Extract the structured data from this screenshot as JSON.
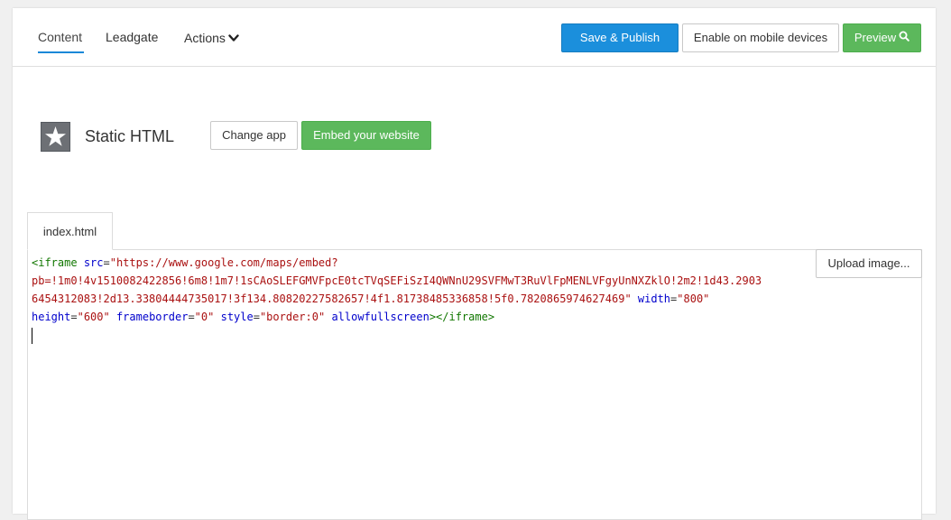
{
  "nav": {
    "tabs": [
      {
        "label": "Content",
        "active": true
      },
      {
        "label": "Leadgate",
        "active": false
      },
      {
        "label": "Actions",
        "active": false
      }
    ]
  },
  "toolbar": {
    "save_publish_label": "Save & Publish",
    "mobile_label": "Enable on mobile devices",
    "preview_label": "Preview",
    "preview_icon": "search-icon"
  },
  "app": {
    "icon": "star-icon",
    "title": "Static HTML",
    "change_app_label": "Change app",
    "embed_label": "Embed your website"
  },
  "editor": {
    "file_tab": "index.html",
    "upload_label": "Upload image...",
    "code": {
      "line1_tag_open": "<iframe",
      "line1_attr_src": "src",
      "line1_eq": "=",
      "line1_src_part1": "\"https://www.google.com/maps/embed?",
      "line2_src_part2": "pb=!1m0!4v1510082422856!6m8!1m7!1sCAoSLEFGMVFpcE0tcTVqSEFiSzI4QWNnU29SVFMwT3RuVlFpMENLVFgyUnNXZklO!2m2!1d43.2903",
      "line3_src_part3": "6454312083!2d13.33804444735017!3f134.80820227582657!4f1.81738485336858!5f0.7820865974627469\"",
      "line3_attr_width": "width",
      "line3_eq": "=",
      "line3_width_val": "\"800\"",
      "line4_attr_height": "height",
      "line4_height_val": "\"600\"",
      "line4_attr_frameborder": "frameborder",
      "line4_frameborder_val": "\"0\"",
      "line4_attr_style": "style",
      "line4_style_val": "\"border:0\"",
      "line4_attr_allowfullscreen": "allowfullscreen",
      "line4_tag_close": "></iframe>"
    }
  },
  "colors": {
    "primary": "#1b8fdc",
    "success": "#5cb85c",
    "tab_underline": "#1a88d8"
  }
}
